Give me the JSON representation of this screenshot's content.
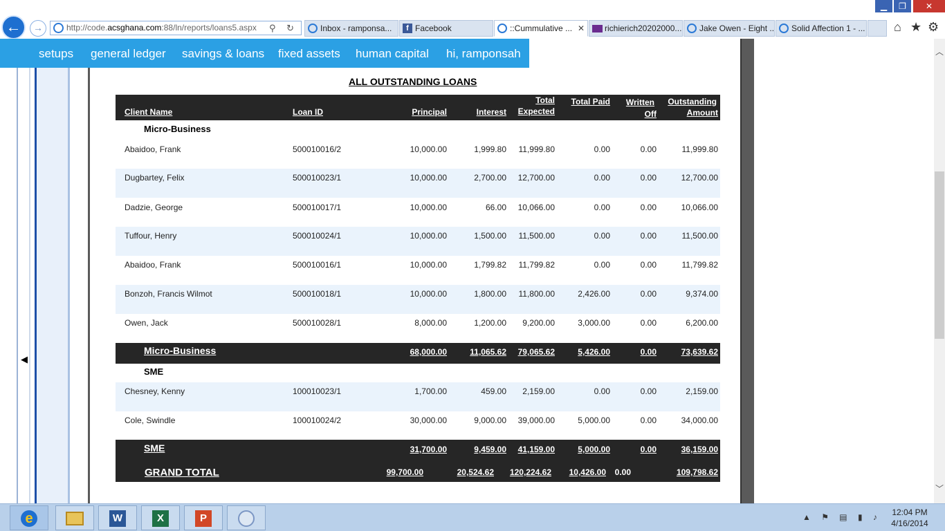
{
  "window_controls": {
    "minimize": "▁",
    "maximize": "❐",
    "close": "✕"
  },
  "browser": {
    "back_glyph": "←",
    "forward_glyph": "→",
    "url_prefix": "http://code.",
    "url_domain": "acsghana.com",
    "url_suffix": ":88/ln/reports/loans5.aspx",
    "address_icons": "⚲ ↻",
    "tabs": [
      {
        "label": "Inbox - ramponsa...",
        "icon": "ie-icon"
      },
      {
        "label": "Facebook",
        "icon": "facebook-icon"
      },
      {
        "label": "::Cummulative ...",
        "icon": "ie-icon",
        "active": true
      },
      {
        "label": "richierich20202000...",
        "icon": "mail-icon"
      },
      {
        "label": "Jake Owen - Eight ...",
        "icon": "ie-icon"
      },
      {
        "label": "Solid Affection 1 - ...",
        "icon": "ie-icon"
      }
    ],
    "tab_close": "✕",
    "home_glyph": "⌂",
    "favorites_glyph": "★",
    "tools_glyph": "⚙"
  },
  "app_nav": {
    "items": [
      "setups",
      "general ledger",
      "savings & loans",
      "fixed assets",
      "human capital",
      "hi, ramponsah"
    ]
  },
  "sidebar": {
    "collapse_glyph": "◀"
  },
  "report": {
    "title": "ALL OUTSTANDING LOANS",
    "headers": {
      "client_name": "Client Name",
      "loan_id": "Loan ID",
      "principal": "Principal",
      "interest": "Interest",
      "total_expected_1": "Total",
      "total_expected_2": "Expected",
      "total_paid": "Total Paid",
      "written_off_1": "Written",
      "written_off_2": "Off",
      "outstanding_1": "Outstanding",
      "outstanding_2": "Amount"
    },
    "groups": [
      {
        "name": "Micro-Business",
        "rows": [
          {
            "client": "Abaidoo, Frank",
            "loan_id": "500010016/2",
            "principal": "10,000.00",
            "interest": "1,999.80",
            "total_expected": "11,999.80",
            "total_paid": "0.00",
            "written_off": "0.00",
            "outstanding": "11,999.80"
          },
          {
            "client": "Dugbartey, Felix",
            "loan_id": "500010023/1",
            "principal": "10,000.00",
            "interest": "2,700.00",
            "total_expected": "12,700.00",
            "total_paid": "0.00",
            "written_off": "0.00",
            "outstanding": "12,700.00"
          },
          {
            "client": "Dadzie, George",
            "loan_id": "500010017/1",
            "principal": "10,000.00",
            "interest": "66.00",
            "total_expected": "10,066.00",
            "total_paid": "0.00",
            "written_off": "0.00",
            "outstanding": "10,066.00"
          },
          {
            "client": "Tuffour, Henry",
            "loan_id": "500010024/1",
            "principal": "10,000.00",
            "interest": "1,500.00",
            "total_expected": "11,500.00",
            "total_paid": "0.00",
            "written_off": "0.00",
            "outstanding": "11,500.00"
          },
          {
            "client": "Abaidoo, Frank",
            "loan_id": "500010016/1",
            "principal": "10,000.00",
            "interest": "1,799.82",
            "total_expected": "11,799.82",
            "total_paid": "0.00",
            "written_off": "0.00",
            "outstanding": "11,799.82"
          },
          {
            "client": "Bonzoh, Francis Wilmot",
            "loan_id": "500010018/1",
            "principal": "10,000.00",
            "interest": "1,800.00",
            "total_expected": "11,800.00",
            "total_paid": "2,426.00",
            "written_off": "0.00",
            "outstanding": "9,374.00"
          },
          {
            "client": "Owen, Jack",
            "loan_id": "500010028/1",
            "principal": "8,000.00",
            "interest": "1,200.00",
            "total_expected": "9,200.00",
            "total_paid": "3,000.00",
            "written_off": "0.00",
            "outstanding": "6,200.00"
          }
        ],
        "subtotal": {
          "label": "Micro-Business",
          "principal": "68,000.00",
          "interest": "11,065.62",
          "total_expected": "79,065.62",
          "total_paid": "5,426.00",
          "written_off": "0.00",
          "outstanding": "73,639.62"
        }
      },
      {
        "name": "SME",
        "rows": [
          {
            "client": "Chesney, Kenny",
            "loan_id": "100010023/1",
            "principal": "1,700.00",
            "interest": "459.00",
            "total_expected": "2,159.00",
            "total_paid": "0.00",
            "written_off": "0.00",
            "outstanding": "2,159.00"
          },
          {
            "client": "Cole, Swindle",
            "loan_id": "100010024/2",
            "principal": "30,000.00",
            "interest": "9,000.00",
            "total_expected": "39,000.00",
            "total_paid": "5,000.00",
            "written_off": "0.00",
            "outstanding": "34,000.00"
          }
        ],
        "subtotal": {
          "label": "SME",
          "principal": "31,700.00",
          "interest": "9,459.00",
          "total_expected": "41,159.00",
          "total_paid": "5,000.00",
          "written_off": "0.00",
          "outstanding": "36,159.00"
        }
      }
    ],
    "grand_total": {
      "label": "GRAND TOTAL",
      "principal": "99,700.00",
      "interest": "20,524.62",
      "total_expected": "120,224.62",
      "total_paid": "10,426.00",
      "written_off": "0.00",
      "outstanding": "109,798.62"
    }
  },
  "taskbar": {
    "apps": [
      {
        "name": "internet-explorer",
        "glyph": "e"
      },
      {
        "name": "file-explorer",
        "glyph": ""
      },
      {
        "name": "word",
        "glyph": "W"
      },
      {
        "name": "excel",
        "glyph": "X"
      },
      {
        "name": "powerpoint",
        "glyph": "P"
      },
      {
        "name": "paint",
        "glyph": ""
      }
    ],
    "tray_glyphs": "▲ ⚑ ▤ ▮ ♪",
    "time": "12:04 PM",
    "date": "4/16/2014"
  }
}
